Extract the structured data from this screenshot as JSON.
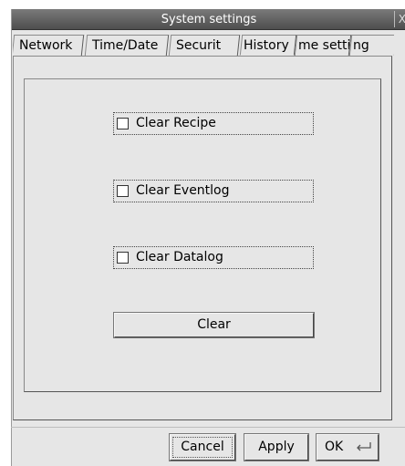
{
  "window": {
    "title": "System settings",
    "close_icon": "close-icon"
  },
  "tabs": [
    {
      "label": "Network",
      "active": false
    },
    {
      "label": "Time/Date",
      "active": false
    },
    {
      "label": "Securit",
      "active": false
    },
    {
      "label": "History",
      "active": true
    },
    {
      "label": "me setting",
      "active": false
    },
    {
      "label": "ng",
      "active": false
    }
  ],
  "history": {
    "clear_recipe": {
      "label": "Clear Recipe",
      "checked": false
    },
    "clear_eventlog": {
      "label": "Clear Eventlog",
      "checked": false
    },
    "clear_datalog": {
      "label": "Clear Datalog",
      "checked": false
    },
    "clear_button": "Clear"
  },
  "footer": {
    "cancel": "Cancel",
    "apply": "Apply",
    "ok": "OK",
    "ok_icon": "enter-key-icon"
  }
}
